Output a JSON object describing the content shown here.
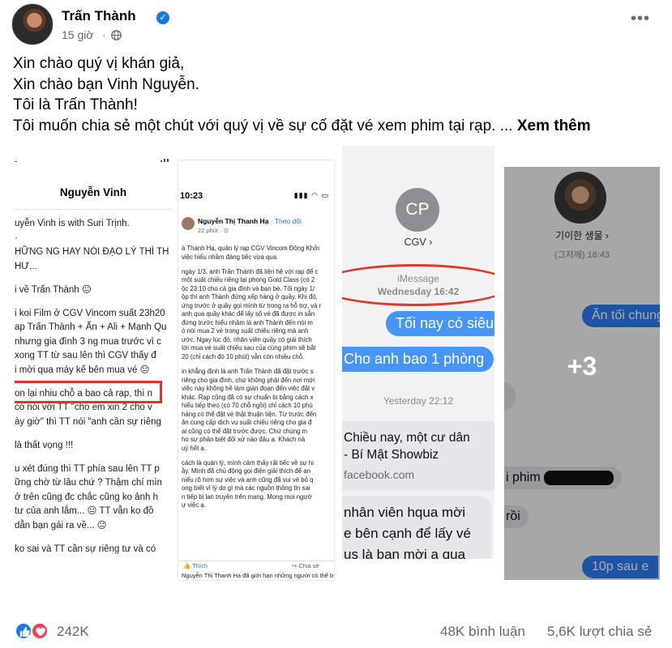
{
  "post": {
    "author": "Trấn Thành",
    "time": "15 giờ",
    "dot": "·",
    "more": "•••",
    "text_lines": [
      "Xin chào quý vị khán giả,",
      "Xin chào bạn Vinh Nguyễn.",
      "Tôi là Trấn Thành!",
      "Tôi muốn chia sẻ một chút với quý vị về sự cố đặt vé xem phim tại rạp. ..."
    ],
    "see_more": "Xem thêm"
  },
  "photo1": {
    "title": "Nguyễn Vinh",
    "lines": [
      "uyễn Vinh is with Suri Trịnh.",
      "·",
      "HỮNG NG HAY NÓI ĐẠO LÝ THÌ TH",
      "HƯ...",
      "",
      "i về Trấn Thành 😐",
      "",
      "i koi Film ở CGV Vincom suất 23h20",
      "ap Trấn Thành + Ấn + Ali + Mạnh Qu",
      "nhưng gia đình 3 ng mua trước vì c",
      " xong TT từ sau lên thì CGV thấy đ",
      "i mời qua máy kế bên mua vé 😐",
      "",
      "on lại nhiu chỗ a bao cả rạp, thì n",
      " có nói với TT \"cho em xin 2 cho v",
      "ày giờ\" thì TT nói \"anh cần sự riêng",
      "",
      " là thất vọng !!!",
      "",
      "u xét đúng thì TT phía sau lên TT p",
      "ững chờ từ lâu chứ ? Thậm chí mìn",
      " ở trên cũng đc chắc cũng ko ảnh h",
      " tư của anh lắm... 😐 TT vẫn ko đồ",
      " dẫn bạn gái ra về... 😐",
      "",
      " ko sai và TT cần sự riêng tư và có"
    ]
  },
  "photo2": {
    "clock": "10:23",
    "status_icons": "▮▮▮ ◠ ▭",
    "name": "Nguyễn Thị Thanh Hạ",
    "follow": " · Theo dõi",
    "time": "22 phút · ⊙",
    "lines": [
      "à Thanh Hạ, quản lý rạp CGV Vincom Đồng Khởi",
      "việc hiểu nhầm đáng tiếc vừa qua.",
      "",
      "ngày 1/3, anh Trấn Thành đã liên hệ với rạp để c",
      "một suất chiếu riêng tại phòng Gold Class (có 2",
      "ộc 23:10 cho cả gia đình và bạn bè. Tối ngày 1/",
      "ộp thì anh Thành đứng xếp hàng ở quầy. Khi đó,",
      "ứng trước ở quầy gọi mình từ trong ra hỗ trợ, và r",
      "anh qua quầy khác để lấy số vé đã được in sẵn",
      "đứng trước hiểu nhầm là anh Thành đến nói m",
      "ó nói mua 2 vé trong suất chiếu riêng mà anh",
      "ước. Ngay lúc đó, nhân viên quầy có giải thích",
      "tới mua vé suất chiếu sau của cùng phim sẽ bắt",
      "20 (chỉ cách đó 10 phút) vẫn còn nhiều chỗ.",
      "",
      "in khẳng định là anh Trấn Thành đã đặt trước s",
      "riêng cho gia đình, chứ không phải đến nơi mới",
      "việc này không hề làm gián đoạn đến việc đặt v",
      "khác. Rạp cũng đã có sự chuẩn bị bằng cách x",
      "hiểu tiếp theo (có 70 chỗ ngồi) chỉ cách 10 phú",
      "hàng có thể đặt vé thật thuận tiện. Từ trước đến",
      "ãn cung cấp dịch vụ suất chiếu riêng cho gia đ",
      "ai cũng có thể đặt trước được. Chứ chúng m",
      "ho sự phân biệt đối xử nào đâu ạ. Khách nà",
      "uý hết ạ.",
      "",
      "cách là quản lý, mình cảm thấy rất tiếc về sự hi",
      "ầy. Mình đã chủ động gọi điện giải thích để an",
      "niểu rõ hơn sự việc và anh cũng đã vui vẻ bỏ q",
      "ong biết vì lý do gì mà các nguồn thông tin sai",
      "n tiếp bị lan truyền trên mạng. Mong mọi ngườ",
      "ự việc ạ."
    ],
    "like": "👍 Thích",
    "share": "↪ Chia sẻ",
    "footer": "Nguyễn Thị Thanh Hạ đã giới hạn những người có thể bình luận về bài viết này."
  },
  "photo3": {
    "initials": "CP",
    "contact": "CGV ›",
    "imessage": "iMessage",
    "timestamp": "Wednesday 16:42",
    "bubble1": "Tối nay có siêu",
    "bubble2": "Cho anh bao 1 phòng",
    "yesterday": "Yesterday 22:12",
    "link_title_1": "Chiều nay, một cư dân",
    "link_title_2": "- Bí Mật Showbiz",
    "link_source": "facebook.com",
    "gray_1": "nhân viên hqua mời",
    "gray_2": "e bên cạnh để lấy vé",
    "gray_3": "us là bạn mời a qua"
  },
  "photo4": {
    "name": "기이한 생물 ›",
    "time": "(그저께) 16:43",
    "k1": "Ăn tối chung",
    "k3": "i phim",
    "k4": "rồi",
    "k5": "10p sau e",
    "more_count": "+3"
  },
  "stats": {
    "reactions": "242K",
    "comments": "48K bình luận",
    "shares": "5,6K lượt chia sẻ"
  },
  "colors": {
    "facebook_blue": "#1877f2",
    "imessage_blue": "#4796f7",
    "highlight_red": "#e8302b"
  }
}
